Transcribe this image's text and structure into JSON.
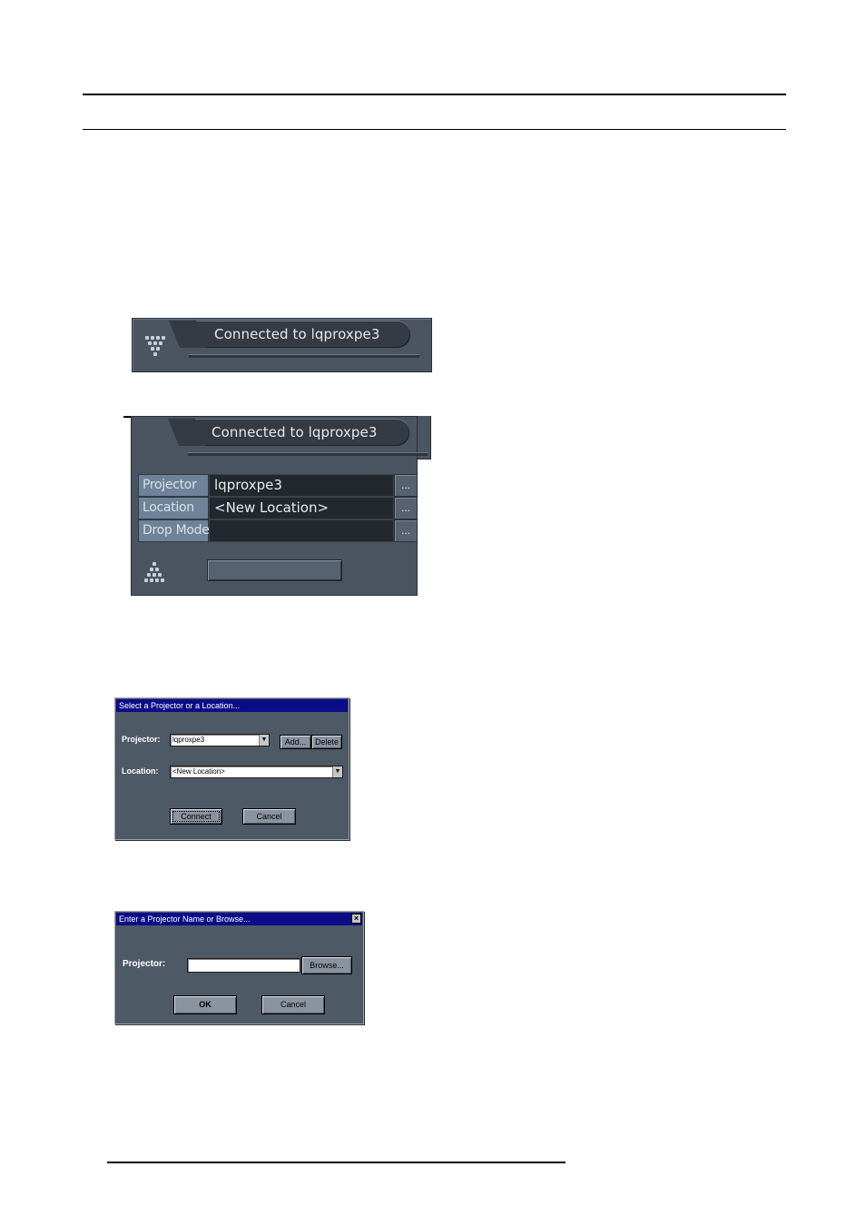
{
  "connection_bar": {
    "status_text": "Connected to lqproxpe3"
  },
  "property_panel": {
    "status_text": "Connected to lqproxpe3",
    "rows": [
      {
        "label": "Projector",
        "value": "lqproxpe3",
        "button": "..."
      },
      {
        "label": "Location",
        "value": "<New Location>",
        "button": "..."
      },
      {
        "label": "Drop Mode",
        "value": "",
        "button": "..."
      }
    ]
  },
  "select_dialog": {
    "title": "Select a Projector or a Location...",
    "projector_label": "Projector:",
    "projector_value": "lqproxpe3",
    "add_label": "Add...",
    "delete_label": "Delete",
    "location_label": "Location:",
    "location_value": "<New Location>",
    "connect_label": "Connect",
    "cancel_label": "Cancel"
  },
  "enter_dialog": {
    "title": "Enter a Projector Name or Browse...",
    "close_glyph": "×",
    "projector_label": "Projector:",
    "projector_value": "",
    "browse_label": "Browse...",
    "ok_label": "OK",
    "cancel_label": "Cancel"
  },
  "colors": {
    "panel": "#4a5561",
    "tab": "#343b44",
    "label_cell": "#6e8299",
    "titlebar": "#0c0c88"
  }
}
